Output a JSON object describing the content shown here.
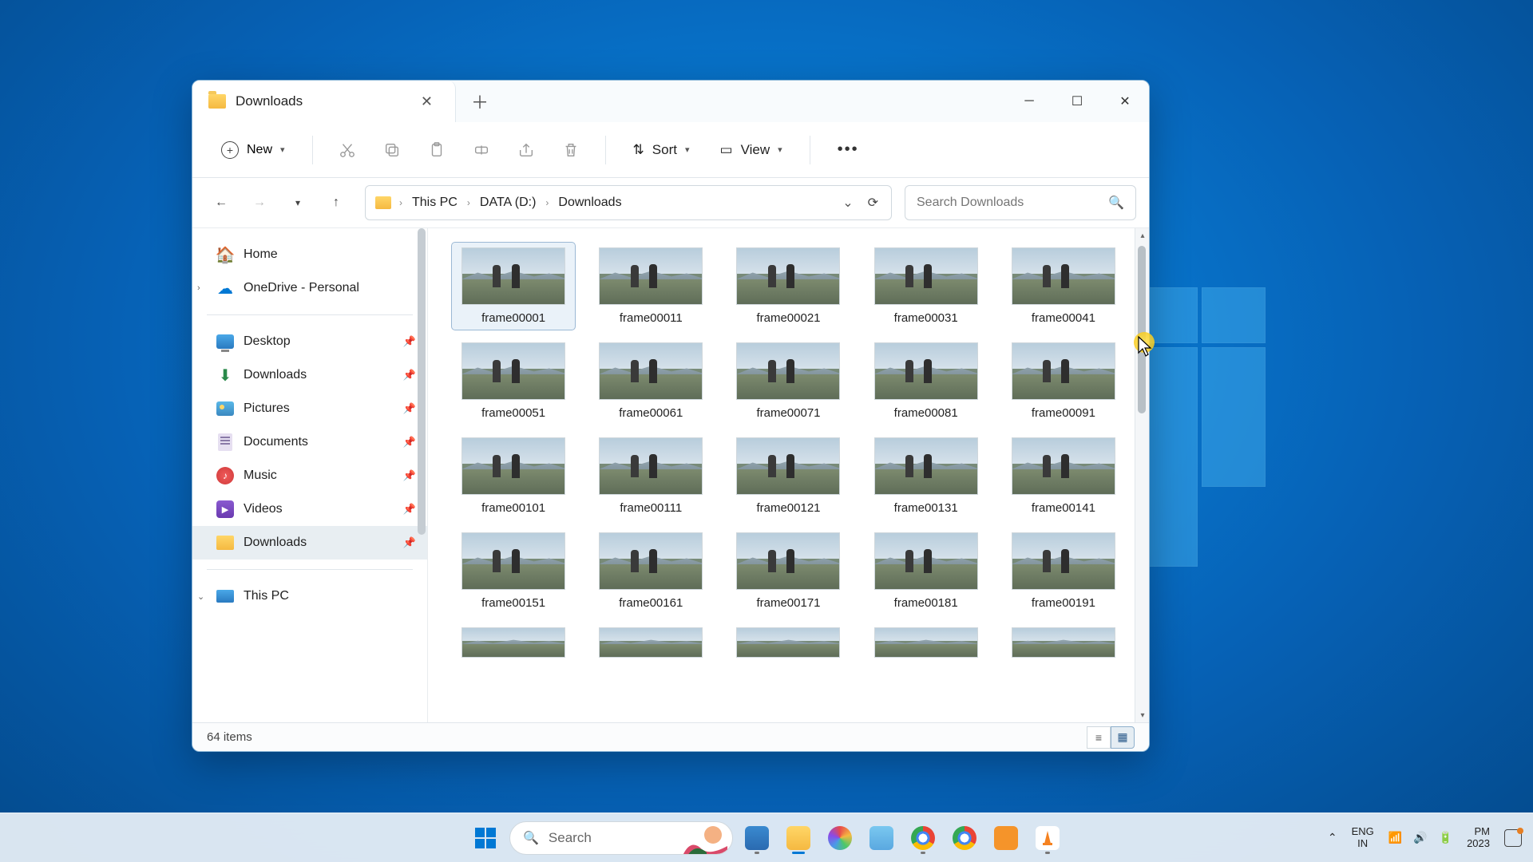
{
  "window": {
    "tab_title": "Downloads",
    "toolbar": {
      "new_label": "New",
      "sort_label": "Sort",
      "view_label": "View"
    },
    "breadcrumb": [
      "This PC",
      "DATA (D:)",
      "Downloads"
    ],
    "search_placeholder": "Search Downloads",
    "sidebar": {
      "top": [
        {
          "label": "Home",
          "icon": "home"
        },
        {
          "label": "OneDrive - Personal",
          "icon": "onedrive",
          "expandable": true
        }
      ],
      "quick": [
        {
          "label": "Desktop",
          "icon": "desktop",
          "pinned": true
        },
        {
          "label": "Downloads",
          "icon": "download",
          "pinned": true
        },
        {
          "label": "Pictures",
          "icon": "pictures",
          "pinned": true
        },
        {
          "label": "Documents",
          "icon": "docs",
          "pinned": true
        },
        {
          "label": "Music",
          "icon": "music",
          "pinned": true
        },
        {
          "label": "Videos",
          "icon": "videos",
          "pinned": true
        },
        {
          "label": "Downloads",
          "icon": "folder",
          "pinned": true,
          "selected": true
        }
      ],
      "bottom": [
        {
          "label": "This PC",
          "icon": "pc",
          "expandable": true,
          "expanded": true
        }
      ]
    },
    "files": [
      "frame00001",
      "frame00011",
      "frame00021",
      "frame00031",
      "frame00041",
      "frame00051",
      "frame00061",
      "frame00071",
      "frame00081",
      "frame00091",
      "frame00101",
      "frame00111",
      "frame00121",
      "frame00131",
      "frame00141",
      "frame00151",
      "frame00161",
      "frame00171",
      "frame00181",
      "frame00191"
    ],
    "status": "64 items"
  },
  "taskbar": {
    "search_placeholder": "Search",
    "lang_top": "ENG",
    "lang_bottom": "IN",
    "time": "PM",
    "date": "2023"
  }
}
